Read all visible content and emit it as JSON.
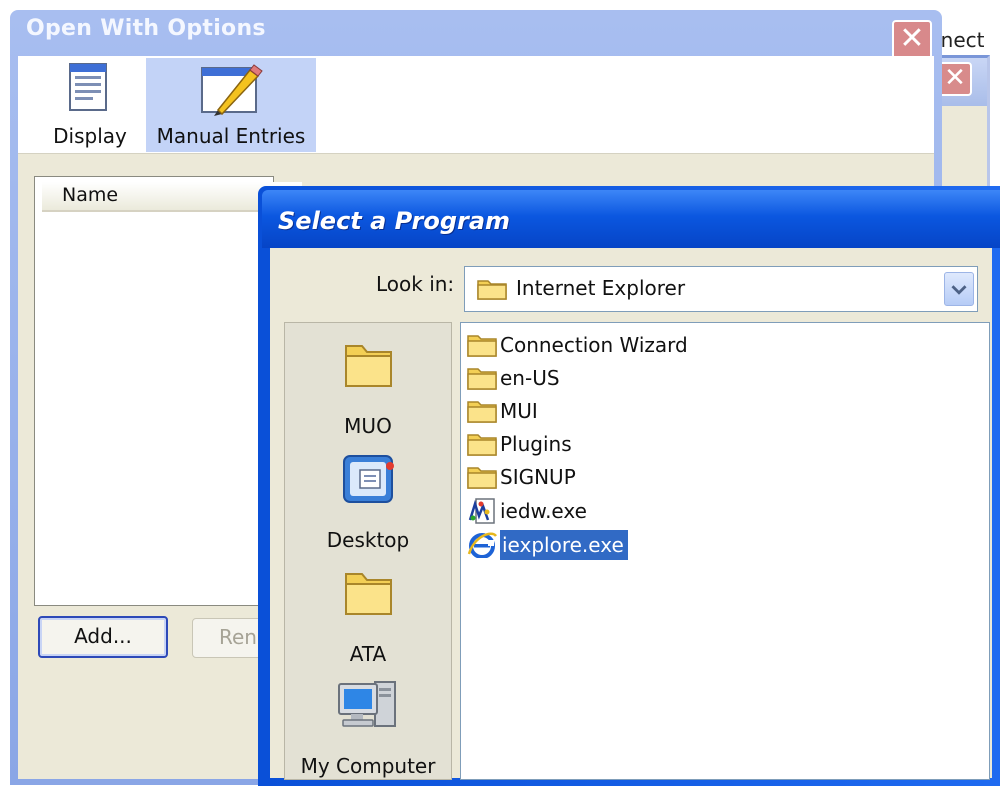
{
  "background_window": {
    "title_snippet": "nnect"
  },
  "open_with_options": {
    "title": "Open With Options",
    "close_glyph": "✕",
    "tabs": [
      {
        "label": "Display",
        "icon": "display-icon"
      },
      {
        "label": "Manual Entries",
        "icon": "pencil-window-icon",
        "selected": true
      }
    ],
    "list": {
      "columns": [
        "Name"
      ]
    },
    "buttons": {
      "add": "Add...",
      "rename_partial": "Ren"
    }
  },
  "select_program": {
    "title": "Select a Program",
    "look_in": {
      "label": "Look in:",
      "value": "Internet Explorer",
      "icon": "folder-icon"
    },
    "places": [
      {
        "label": "MUO",
        "icon": "folder-icon"
      },
      {
        "label": "Desktop",
        "icon": "desktop-icon"
      },
      {
        "label": "ATA",
        "icon": "folder-icon"
      },
      {
        "label": "My Computer",
        "icon": "my-computer-icon"
      }
    ],
    "files": [
      {
        "name": "Connection Wizard",
        "icon": "folder-icon"
      },
      {
        "name": "en-US",
        "icon": "folder-icon"
      },
      {
        "name": "MUI",
        "icon": "folder-icon"
      },
      {
        "name": "Plugins",
        "icon": "folder-icon"
      },
      {
        "name": "SIGNUP",
        "icon": "folder-icon"
      },
      {
        "name": "iedw.exe",
        "icon": "exe-icon"
      },
      {
        "name": "iexplore.exe",
        "icon": "internet-explorer-icon",
        "selected": true
      }
    ]
  },
  "colors": {
    "xp_blue": "#0b57e0",
    "dialog_face": "#ece9d8",
    "selection": "#316ac5",
    "inactive_title": "#a8bef0"
  }
}
